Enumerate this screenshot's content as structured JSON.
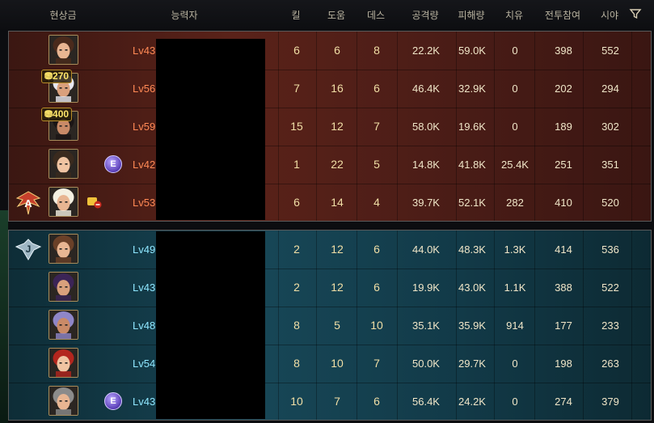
{
  "headers": {
    "bounty": "현상금",
    "player": "능력자",
    "kills": "킬",
    "assists": "도움",
    "deaths": "데스",
    "attack": "공격량",
    "damage_taken": "피해량",
    "heal": "치유",
    "participation": "전투참여",
    "vision": "시야"
  },
  "red_team": [
    {
      "level": "Lv43",
      "kills": "6",
      "assists": "6",
      "deaths": "8",
      "attack": "22.2K",
      "damage_taken": "59.0K",
      "heal": "0",
      "participation": "398",
      "vision": "552",
      "portrait": "portrait-brunette-woman",
      "bounty": "",
      "has_rank_emblem": false
    },
    {
      "level": "Lv56",
      "kills": "7",
      "assists": "16",
      "deaths": "6",
      "attack": "46.4K",
      "damage_taken": "32.9K",
      "heal": "0",
      "participation": "202",
      "vision": "294",
      "portrait": "portrait-white-hair",
      "bounty": "270",
      "has_rank_emblem": false
    },
    {
      "level": "Lv59",
      "kills": "15",
      "assists": "12",
      "deaths": "7",
      "attack": "58.0K",
      "damage_taken": "19.6K",
      "heal": "0",
      "participation": "189",
      "vision": "302",
      "portrait": "portrait-dark-hair-woman",
      "bounty": "400",
      "has_rank_emblem": false
    },
    {
      "level": "Lv42",
      "kills": "1",
      "assists": "22",
      "deaths": "5",
      "attack": "14.8K",
      "damage_taken": "41.8K",
      "heal": "25.4K",
      "participation": "251",
      "vision": "351",
      "portrait": "portrait-bearded-man",
      "bounty": "",
      "has_rank_emblem": true
    },
    {
      "level": "Lv53",
      "kills": "6",
      "assists": "14",
      "deaths": "4",
      "attack": "39.7K",
      "damage_taken": "52.1K",
      "heal": "282",
      "participation": "410",
      "vision": "520",
      "portrait": "portrait-blonde-hat",
      "bounty": "",
      "has_rank_emblem": false
    }
  ],
  "blue_team": [
    {
      "level": "Lv49",
      "kills": "2",
      "assists": "12",
      "deaths": "6",
      "attack": "44.0K",
      "damage_taken": "48.3K",
      "heal": "1.3K",
      "participation": "414",
      "vision": "536",
      "portrait": "portrait-brown-hair-woman",
      "has_rank_emblem": false
    },
    {
      "level": "Lv43",
      "kills": "2",
      "assists": "12",
      "deaths": "6",
      "attack": "19.9K",
      "damage_taken": "43.0K",
      "heal": "1.1K",
      "participation": "388",
      "vision": "522",
      "portrait": "portrait-purple-hair-woman",
      "has_rank_emblem": false
    },
    {
      "level": "Lv48",
      "kills": "8",
      "assists": "5",
      "deaths": "10",
      "attack": "35.1K",
      "damage_taken": "35.9K",
      "heal": "914",
      "participation": "177",
      "vision": "233",
      "portrait": "portrait-masked-figure",
      "has_rank_emblem": false
    },
    {
      "level": "Lv54",
      "kills": "8",
      "assists": "10",
      "deaths": "7",
      "attack": "50.0K",
      "damage_taken": "29.7K",
      "heal": "0",
      "participation": "198",
      "vision": "263",
      "portrait": "portrait-red-hair-woman",
      "has_rank_emblem": false
    },
    {
      "level": "Lv43",
      "kills": "10",
      "assists": "7",
      "deaths": "6",
      "attack": "56.4K",
      "damage_taken": "24.2K",
      "heal": "0",
      "participation": "274",
      "vision": "379",
      "portrait": "portrait-grey-hair-man",
      "has_rank_emblem": true
    }
  ],
  "rank_emblem_letter": "E",
  "red_emblem_letter": "A",
  "blue_emblem_letter": "J",
  "colors": {
    "red_level": "#ff8a55",
    "blue_level": "#8fe7ff",
    "stat": "#f1dfa6"
  }
}
